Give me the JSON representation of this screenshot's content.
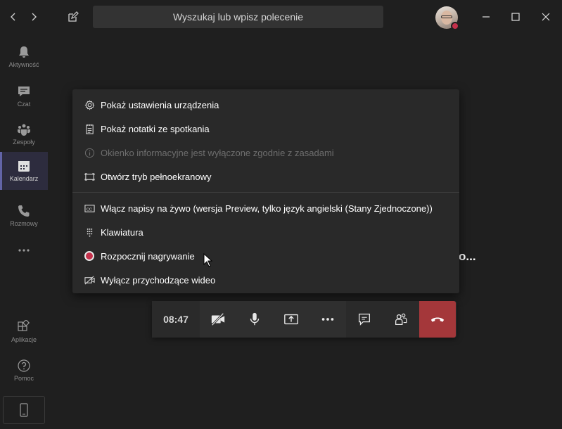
{
  "search": {
    "placeholder": "Wyszukaj lub wpisz polecenie"
  },
  "colors": {
    "accent": "#6264a7",
    "hangup": "#a4373a",
    "recording": "#c4314b",
    "menu_bg": "#292929"
  },
  "rail": {
    "items": [
      {
        "label": "Aktywność",
        "icon": "bell-icon"
      },
      {
        "label": "Czat",
        "icon": "chat-icon"
      },
      {
        "label": "Zespoły",
        "icon": "teams-icon"
      },
      {
        "label": "Kalendarz",
        "icon": "calendar-icon",
        "active": true
      },
      {
        "label": "Rozmowy",
        "icon": "phone-icon"
      },
      {
        "label": "",
        "icon": "more-icon"
      }
    ],
    "bottom": [
      {
        "label": "Aplikacje",
        "icon": "apps-icon"
      },
      {
        "label": "Pomoc",
        "icon": "help-icon"
      }
    ]
  },
  "menu": {
    "items": [
      {
        "label": "Pokaż ustawienia urządzenia",
        "icon": "gear-icon",
        "disabled": false
      },
      {
        "label": "Pokaż notatki ze spotkania",
        "icon": "notes-icon",
        "disabled": false
      },
      {
        "label": "Okienko informacyjne jest wyłączone zgodnie z zasadami",
        "icon": "info-icon",
        "disabled": true
      },
      {
        "label": "Otwórz tryb pełnoekranowy",
        "icon": "fullscreen-icon",
        "disabled": false
      },
      {
        "label": "Włącz napisy na żywo (wersja Preview, tylko język angielski (Stany Zjednoczone))",
        "icon": "captions-icon",
        "disabled": false
      },
      {
        "label": "Klawiatura",
        "icon": "keypad-icon",
        "disabled": false
      },
      {
        "label": "Rozpocznij nagrywanie",
        "icon": "record-icon",
        "disabled": false
      },
      {
        "label": "Wyłącz przychodzące wideo",
        "icon": "video-off-icon",
        "disabled": false
      }
    ]
  },
  "background_text": "o...",
  "callbar": {
    "timer": "08:47"
  }
}
